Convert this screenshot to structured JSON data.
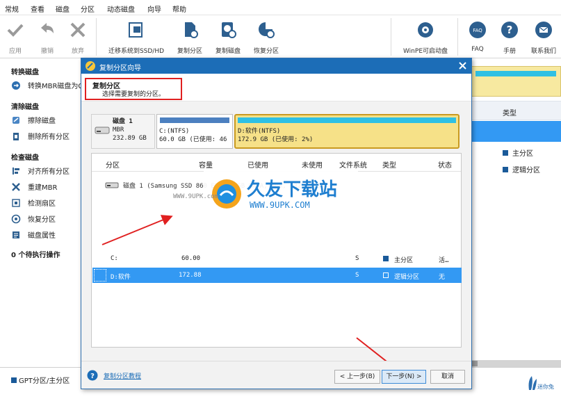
{
  "menu": [
    "常规",
    "查看",
    "磁盘",
    "分区",
    "动态磁盘",
    "向导",
    "帮助"
  ],
  "toolbar": {
    "apply": "应用",
    "undo": "撤销",
    "discard": "放弃",
    "migrate": "迁移系统到SSD/HD",
    "copy_partition": "复制分区",
    "copy_disk": "复制磁盘",
    "recover": "恢复分区",
    "winpe": "WinPE可启动盘",
    "faq": "FAQ",
    "manual": "手册",
    "contact": "联系我们"
  },
  "sidebar": {
    "convert_title": "转换磁盘",
    "convert_mbr": "转换MBR磁盘为G",
    "clear_title": "清除磁盘",
    "wipe_disk": "擦除磁盘",
    "delete_all": "删除所有分区",
    "check_title": "检查磁盘",
    "align_all": "对齐所有分区",
    "rebuild_mbr": "重建MBR",
    "bad_sector": "检测扇区",
    "recover": "恢复分区",
    "disk_props": "磁盘属性",
    "pending": "0 个待执行操作"
  },
  "right_panel": {
    "type_header": "类型",
    "legend_primary": "主分区",
    "legend_logical": "逻辑分区"
  },
  "bottom": {
    "gpt_label": "GPT分区/主分区",
    "brand": "迷你兔"
  },
  "dialog": {
    "title": "复制分区向导",
    "heading": "复制分区",
    "subheading": "选择需要复制的分区。",
    "disk": {
      "name": "磁盘 1",
      "type": "MBR",
      "size": "232.89 GB"
    },
    "seg_c": {
      "line1": "C:(NTFS)",
      "line2": "60.0 GB (已使用: 46"
    },
    "seg_d": {
      "line1": "D:软件(NTFS)",
      "line2": "172.9 GB (已使用: 2%)"
    },
    "table": {
      "headers": [
        "分区",
        "容量",
        "已使用",
        "未使用",
        "文件系统",
        "类型",
        "状态"
      ],
      "disk_row": "磁盘 1 (Samsung SSD 860 EVO 250GB SATA, MBR, 232.89 GB)",
      "rows": [
        {
          "name": "C:",
          "capacity": "60.00",
          "used": "",
          "unused": "",
          "fs": "S",
          "type": "主分区",
          "status": "活…"
        },
        {
          "name": "D:软件",
          "capacity": "172.88",
          "used": "",
          "unused": "",
          "fs": "S",
          "type": "逻辑分区",
          "status": "无"
        }
      ]
    },
    "help_link": "复制分区教程",
    "prev": "< 上一步(B)",
    "next": "下一步(N) >",
    "cancel": "取消"
  },
  "watermark": {
    "title": "久友下载站",
    "url": "WWW.9UPK.COM",
    "url2": "WWW.9UPK.com"
  },
  "colors": {
    "title_bar": "#1c6db7",
    "selected": "#3399f3",
    "disk_d": "#f6e188",
    "annotation": "#e02020"
  }
}
